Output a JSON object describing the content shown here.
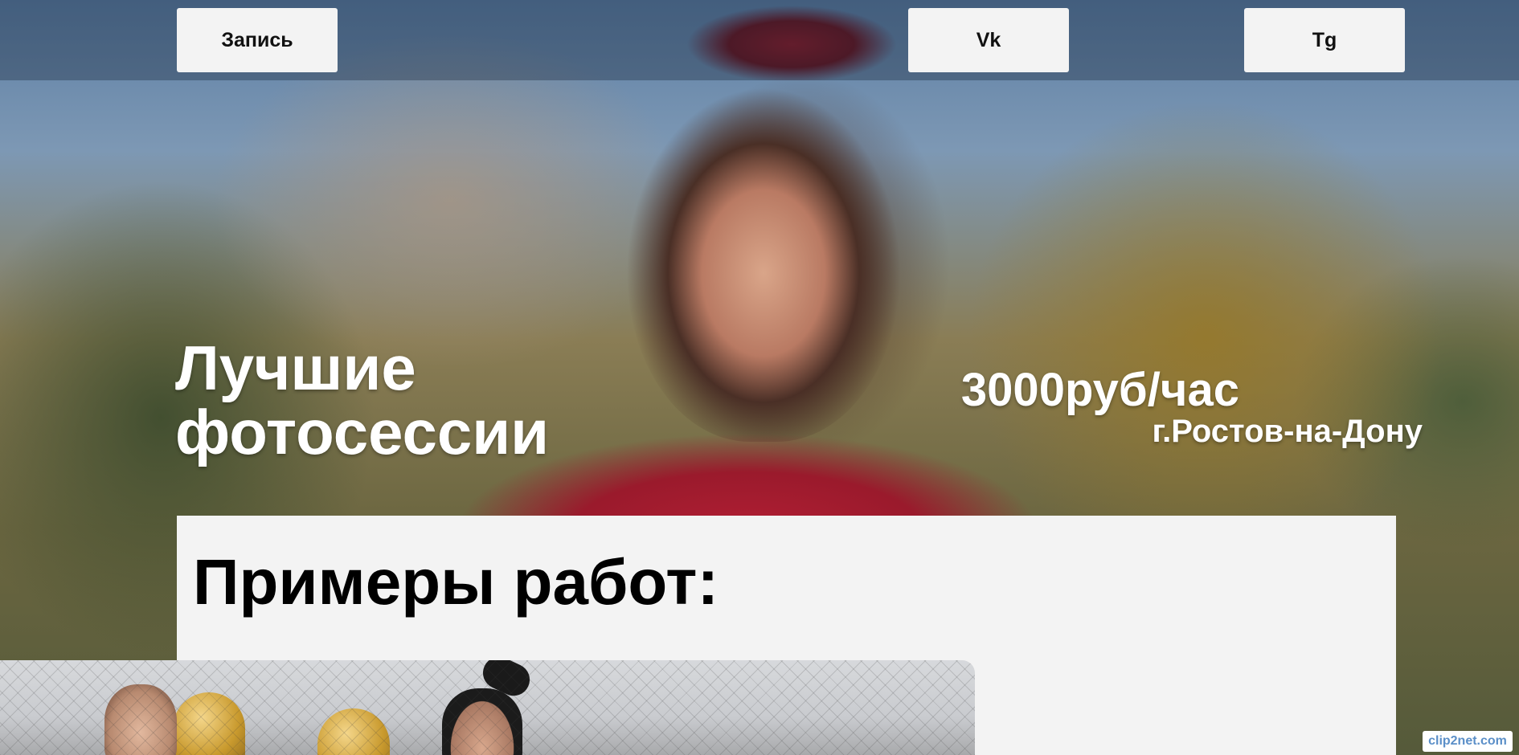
{
  "nav": {
    "book_label": "Запись",
    "vk_label": "Vk",
    "tg_label": "Tg"
  },
  "hero": {
    "title_line1": "Лучшие",
    "title_line2": "фотосессии",
    "price": "3000руб/час",
    "city": "г.Ростов-на-Дону"
  },
  "works": {
    "title": "Примеры работ:"
  },
  "watermark": {
    "text": "clip2net.com"
  },
  "colors": {
    "button_bg": "#f3f3f3",
    "section_bg": "#f3f3f3",
    "hero_text": "#ffffff",
    "title_text": "#000000"
  }
}
